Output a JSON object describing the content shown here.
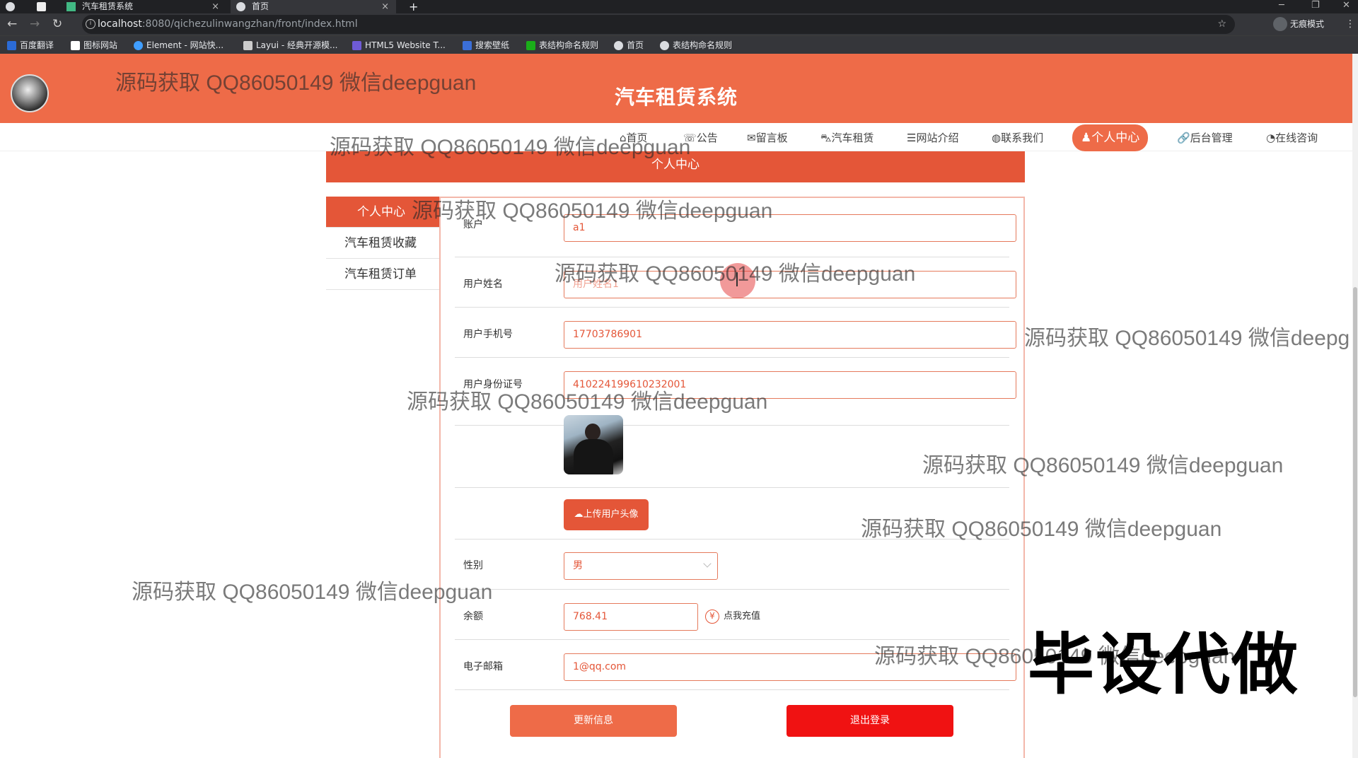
{
  "browser": {
    "tabs": [
      {
        "label": ""
      },
      {
        "label": "汽车租赁系统",
        "close": "×"
      },
      {
        "label": "首页",
        "close": "×"
      }
    ],
    "new_tab": "+",
    "url_host": "localhost",
    "url_rest": ":8080/qichezulinwangzhan/front/index.html",
    "profile_label": "无痕模式",
    "bookmarks": [
      {
        "label": "百度翻译",
        "color": "#2b6bd6"
      },
      {
        "label": "图标网站",
        "color": "#ffffff"
      },
      {
        "label": "Element - 网站快...",
        "color": "#409eff"
      },
      {
        "label": "Layui - 经典开源模...",
        "color": "#ffffff"
      },
      {
        "label": "HTML5 Website T...",
        "color": "#6f5bd6"
      },
      {
        "label": "搜索壁纸",
        "color": "#3b6fd8"
      },
      {
        "label": "表结构命名规则",
        "color": "#1aad19"
      },
      {
        "label": "首页",
        "color": "#dadce0"
      },
      {
        "label": "表结构命名规则",
        "color": "#dadce0"
      }
    ]
  },
  "site": {
    "title": "汽车租赁系统",
    "brand_color": "#ee6b48",
    "menu": [
      {
        "label": "⌂首页"
      },
      {
        "label": "☏公告"
      },
      {
        "label": "✉留言板"
      },
      {
        "label": "⛍汽车租赁"
      },
      {
        "label": "☰网站介绍"
      },
      {
        "label": "◍联系我们"
      },
      {
        "label": "♟个人中心",
        "active": true
      },
      {
        "label": "🔗后台管理"
      },
      {
        "label": "◔在线咨询"
      }
    ]
  },
  "banner": "个人中心",
  "sidebar": [
    {
      "label": "个人中心",
      "active": true
    },
    {
      "label": "汽车租赁收藏"
    },
    {
      "label": "汽车租赁订单"
    }
  ],
  "form": {
    "account": {
      "label": "账户",
      "value": "a1"
    },
    "name": {
      "label": "用户姓名",
      "value": "",
      "placeholder": "用户姓名1"
    },
    "phone": {
      "label": "用户手机号",
      "value": "17703786901"
    },
    "idcard": {
      "label": "用户身份证号",
      "value": "410224199610232001"
    },
    "upload_label": "上传用户头像",
    "gender": {
      "label": "性别",
      "value": "男"
    },
    "balance": {
      "label": "余额",
      "value": "768.41",
      "charge_label": "点我充值",
      "charge_icon": "¥"
    },
    "email": {
      "label": "电子邮箱",
      "value": "1@qq.com"
    },
    "update_button": "更新信息",
    "logout_button": "退出登录"
  },
  "watermark": {
    "text": "源码获取 QQ86050149 微信deepguan",
    "text_cut": "源码获取 QQ86050149 微信deepg",
    "big": "毕设代做"
  }
}
